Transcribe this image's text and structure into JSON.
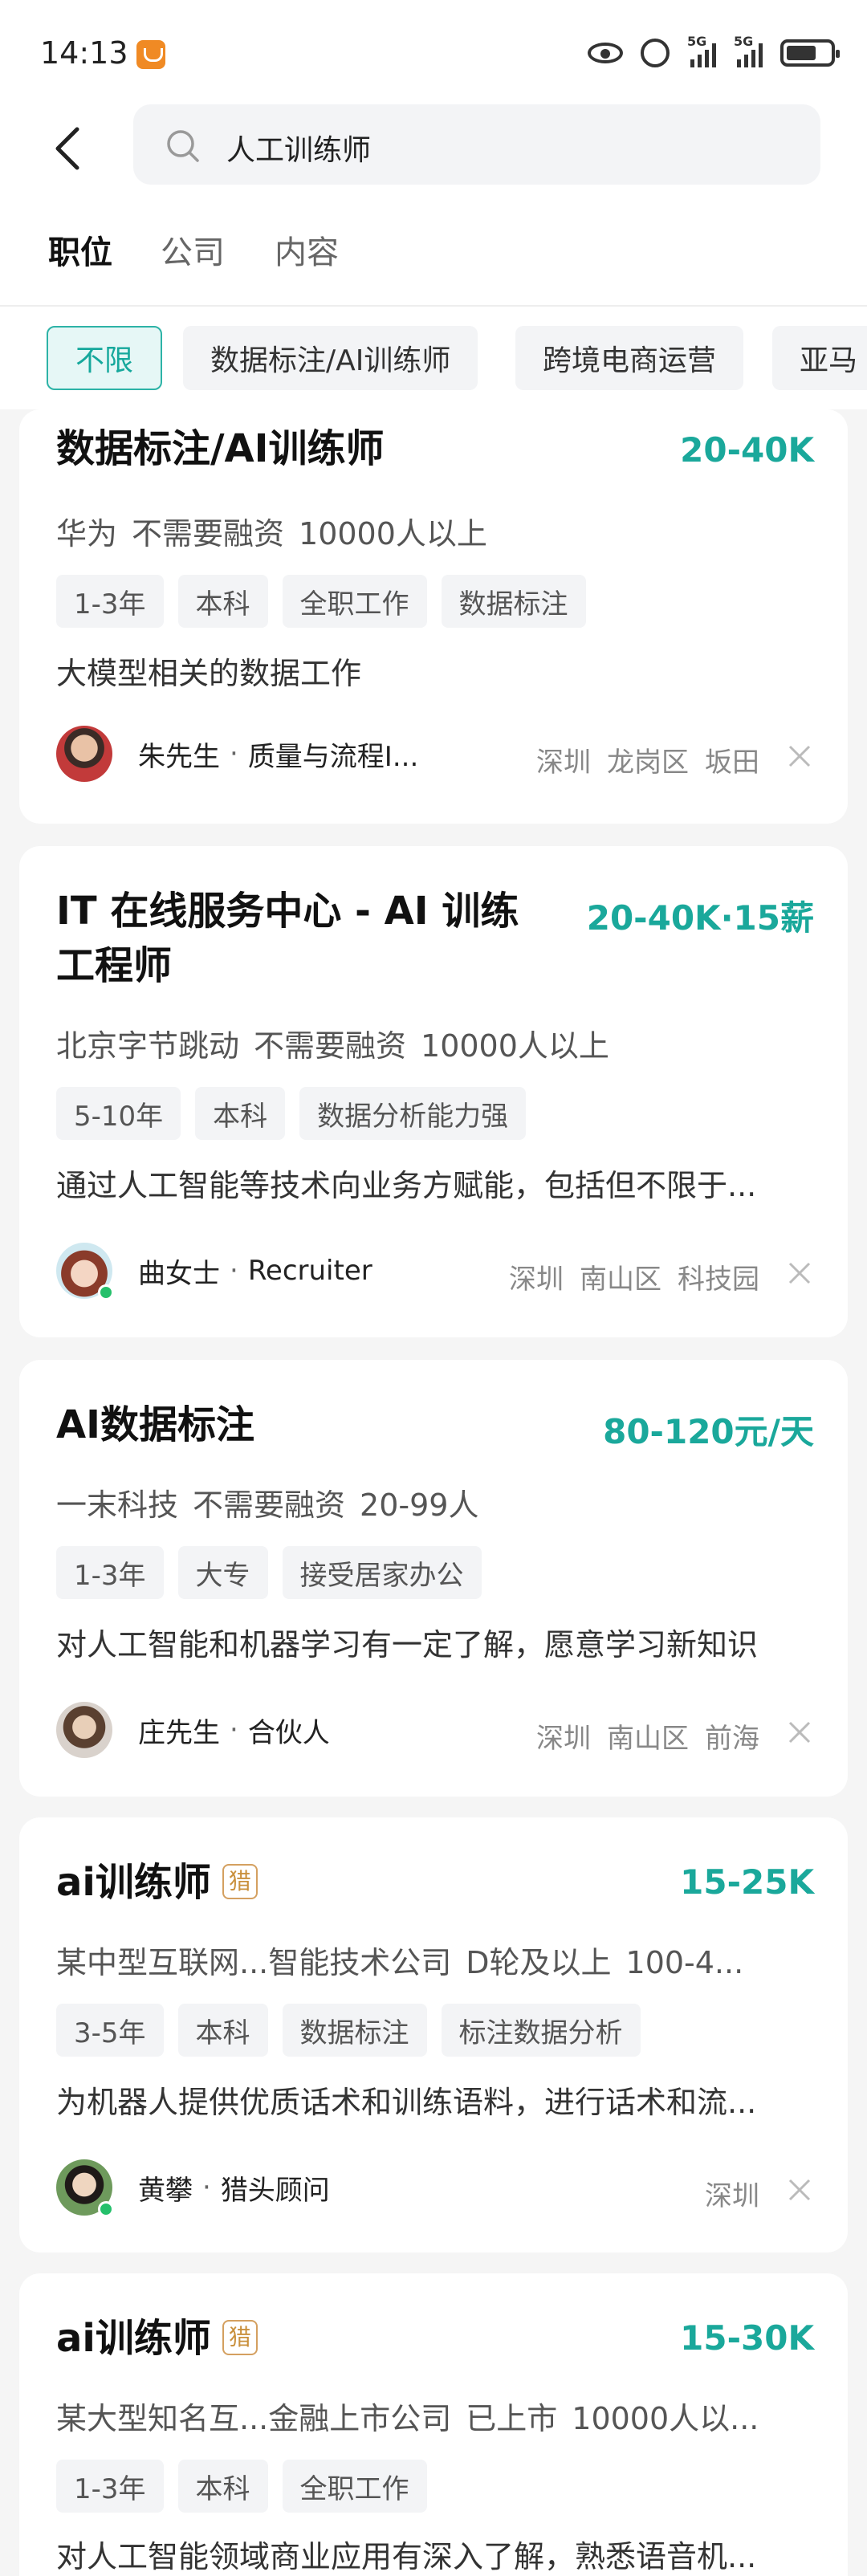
{
  "status_bar": {
    "time": "14:13",
    "network_label_1": "5G",
    "network_label_2": "5G"
  },
  "search": {
    "query": "人工训练师"
  },
  "tabs": [
    {
      "label": "职位",
      "active": true
    },
    {
      "label": "公司",
      "active": false
    },
    {
      "label": "内容",
      "active": false
    }
  ],
  "filters": [
    {
      "label": "不限",
      "active": true
    },
    {
      "label": "数据标注/AI训练师",
      "active": false
    },
    {
      "label": "跨境电商运营",
      "active": false
    },
    {
      "label": "亚马",
      "active": false
    }
  ],
  "jobs": [
    {
      "title": "数据标注/AI训练师",
      "salary": "20-40K",
      "company": [
        "华为",
        "不需要融资",
        "10000人以上"
      ],
      "tags": [
        "1-3年",
        "本科",
        "全职工作",
        "数据标注"
      ],
      "desc": "大模型相关的数据工作",
      "recruiter_name": "朱先生",
      "recruiter_role": "质量与流程I...",
      "location": [
        "深圳",
        "龙岗区",
        "坂田"
      ]
    },
    {
      "title_line1": "IT 在线服务中心 - AI 训练",
      "title_line2": "工程师",
      "salary": "20-40K·15薪",
      "company": [
        "北京字节跳动",
        "不需要融资",
        "10000人以上"
      ],
      "tags": [
        "5-10年",
        "本科",
        "数据分析能力强"
      ],
      "desc": "通过人工智能等技术向业务方赋能，包括但不限于...",
      "recruiter_name": "曲女士",
      "recruiter_role": "Recruiter",
      "location": [
        "深圳",
        "南山区",
        "科技园"
      ]
    },
    {
      "title": "AI数据标注",
      "salary": "80-120元/天",
      "company": [
        "一末科技",
        "不需要融资",
        "20-99人"
      ],
      "tags": [
        "1-3年",
        "大专",
        "接受居家办公"
      ],
      "desc": "对人工智能和机器学习有一定了解，愿意学习新知识",
      "recruiter_name": "庄先生",
      "recruiter_role": "合伙人",
      "location": [
        "深圳",
        "南山区",
        "前海"
      ]
    },
    {
      "title": "ai训练师",
      "badge": "猎",
      "salary": "15-25K",
      "company": [
        "某中型互联网...智能技术公司",
        "D轮及以上",
        "100-4..."
      ],
      "tags": [
        "3-5年",
        "本科",
        "数据标注",
        "标注数据分析"
      ],
      "desc": "为机器人提供优质话术和训练语料，进行话术和流...",
      "recruiter_name": "黄攀",
      "recruiter_role": "猎头顾问",
      "location": [
        "深圳"
      ]
    },
    {
      "title": "ai训练师",
      "badge": "猎",
      "salary": "15-30K",
      "company": [
        "某大型知名互...金融上市公司",
        "已上市",
        "10000人以..."
      ],
      "tags": [
        "1-3年",
        "本科",
        "全职工作"
      ],
      "desc": "对人工智能领域商业应用有深入了解，熟悉语音机..."
    }
  ],
  "colors": {
    "accent": "#1aa89b",
    "chip_active_bg": "#e6f7f6",
    "online": "#25c06b"
  }
}
